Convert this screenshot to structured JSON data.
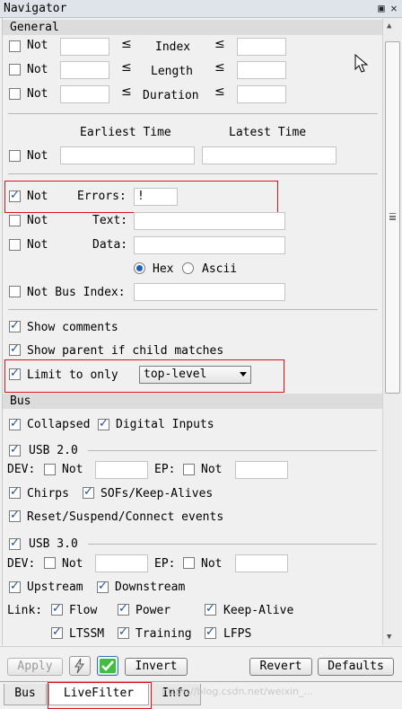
{
  "window": {
    "title": "Navigator",
    "pin_icon": "pin-icon",
    "close_icon": "close-icon"
  },
  "general": {
    "header": "General",
    "not": "Not",
    "le": "≤",
    "rows": [
      {
        "label": "Index"
      },
      {
        "label": "Length"
      },
      {
        "label": "Duration"
      }
    ],
    "earliest_time": "Earliest Time",
    "latest_time": "Latest Time",
    "errors": {
      "not_checked": true,
      "label": "Errors:",
      "value": "!"
    },
    "text_label": "Text:",
    "data_label": "Data:",
    "hex": "Hex",
    "ascii": "Ascii",
    "bus_index": "Not Bus Index:",
    "show_comments": "Show comments",
    "show_parent": "Show parent if child matches",
    "limit_to_only": "Limit to only",
    "limit_value": "top-level"
  },
  "bus": {
    "header": "Bus",
    "collapsed": "Collapsed",
    "digital_inputs": "Digital Inputs",
    "usb2": "USB 2.0",
    "dev": "DEV:",
    "ep": "EP:",
    "not": "Not",
    "chirps": "Chirps",
    "sofs": "SOFs/Keep-Alives",
    "reset": "Reset/Suspend/Connect events",
    "usb3": "USB 3.0",
    "upstream": "Upstream",
    "downstream": "Downstream",
    "link": "Link:",
    "flow": "Flow",
    "power": "Power",
    "keepalive": "Keep-Alive",
    "ltssm": "LTSSM",
    "training": "Training",
    "lfps": "LFPS"
  },
  "buttons": {
    "apply": "Apply",
    "invert": "Invert",
    "revert": "Revert",
    "defaults": "Defaults"
  },
  "tabs": {
    "bus": "Bus",
    "livefilter": "LiveFilter",
    "info": "Info"
  },
  "watermark": "https://blog.csdn.net/weixin_..."
}
